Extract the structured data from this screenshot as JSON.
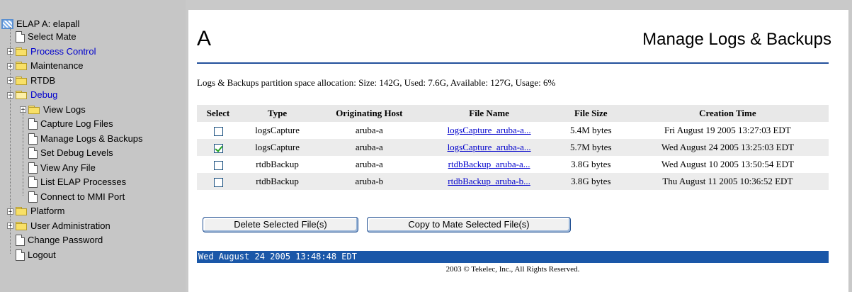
{
  "tree": {
    "root_label": "ELAP A: elapall",
    "items": [
      {
        "label": "Select Mate",
        "type": "page"
      },
      {
        "label": "Process Control",
        "type": "folder",
        "link": true
      },
      {
        "label": "Maintenance",
        "type": "folder"
      },
      {
        "label": "RTDB",
        "type": "folder"
      },
      {
        "label": "Debug",
        "type": "folder-open",
        "link": true
      },
      {
        "label": "View Logs",
        "type": "folder",
        "indent": 1
      },
      {
        "label": "Capture Log Files",
        "type": "page",
        "indent": 1
      },
      {
        "label": "Manage Logs & Backups",
        "type": "page",
        "indent": 1
      },
      {
        "label": "Set Debug Levels",
        "type": "page",
        "indent": 1
      },
      {
        "label": "View Any File",
        "type": "page",
        "indent": 1
      },
      {
        "label": "List ELAP Processes",
        "type": "page",
        "indent": 1
      },
      {
        "label": "Connect to MMI Port",
        "type": "page",
        "indent": 1
      },
      {
        "label": "Platform",
        "type": "folder"
      },
      {
        "label": "User Administration",
        "type": "folder"
      },
      {
        "label": "Change Password",
        "type": "page"
      },
      {
        "label": "Logout",
        "type": "page"
      }
    ]
  },
  "header": {
    "letter": "A",
    "title": "Manage Logs & Backups"
  },
  "space_info": "Logs & Backups partition space allocation: Size: 142G, Used: 7.6G, Available: 127G, Usage: 6%",
  "table": {
    "columns": [
      "Select",
      "Type",
      "Originating Host",
      "File Name",
      "File Size",
      "Creation Time"
    ],
    "rows": [
      {
        "selected": false,
        "type": "logsCapture",
        "host": "aruba-a",
        "file": "logsCapture_aruba-a...",
        "size": "5.4M bytes",
        "created": "Fri August 19 2005 13:27:03 EDT"
      },
      {
        "selected": true,
        "type": "logsCapture",
        "host": "aruba-a",
        "file": "logsCapture_aruba-a...",
        "size": "5.7M bytes",
        "created": "Wed August 24 2005 13:25:03 EDT"
      },
      {
        "selected": false,
        "type": "rtdbBackup",
        "host": "aruba-a",
        "file": "rtdbBackup_aruba-a...",
        "size": "3.8G bytes",
        "created": "Wed August 10 2005 13:50:54 EDT"
      },
      {
        "selected": false,
        "type": "rtdbBackup",
        "host": "aruba-b",
        "file": "rtdbBackup_aruba-b...",
        "size": "3.8G bytes",
        "created": "Thu August 11 2005 10:36:52 EDT"
      }
    ]
  },
  "buttons": {
    "delete": "Delete Selected File(s)",
    "copy": "Copy to Mate Selected File(s)"
  },
  "status_time": "Wed August 24 2005 13:48:48 EDT",
  "footer": "2003 © Tekelec, Inc., All Rights Reserved.",
  "colors": {
    "accent": "#23509c",
    "status_bar": "#1a57a8",
    "link": "#0000cc"
  }
}
